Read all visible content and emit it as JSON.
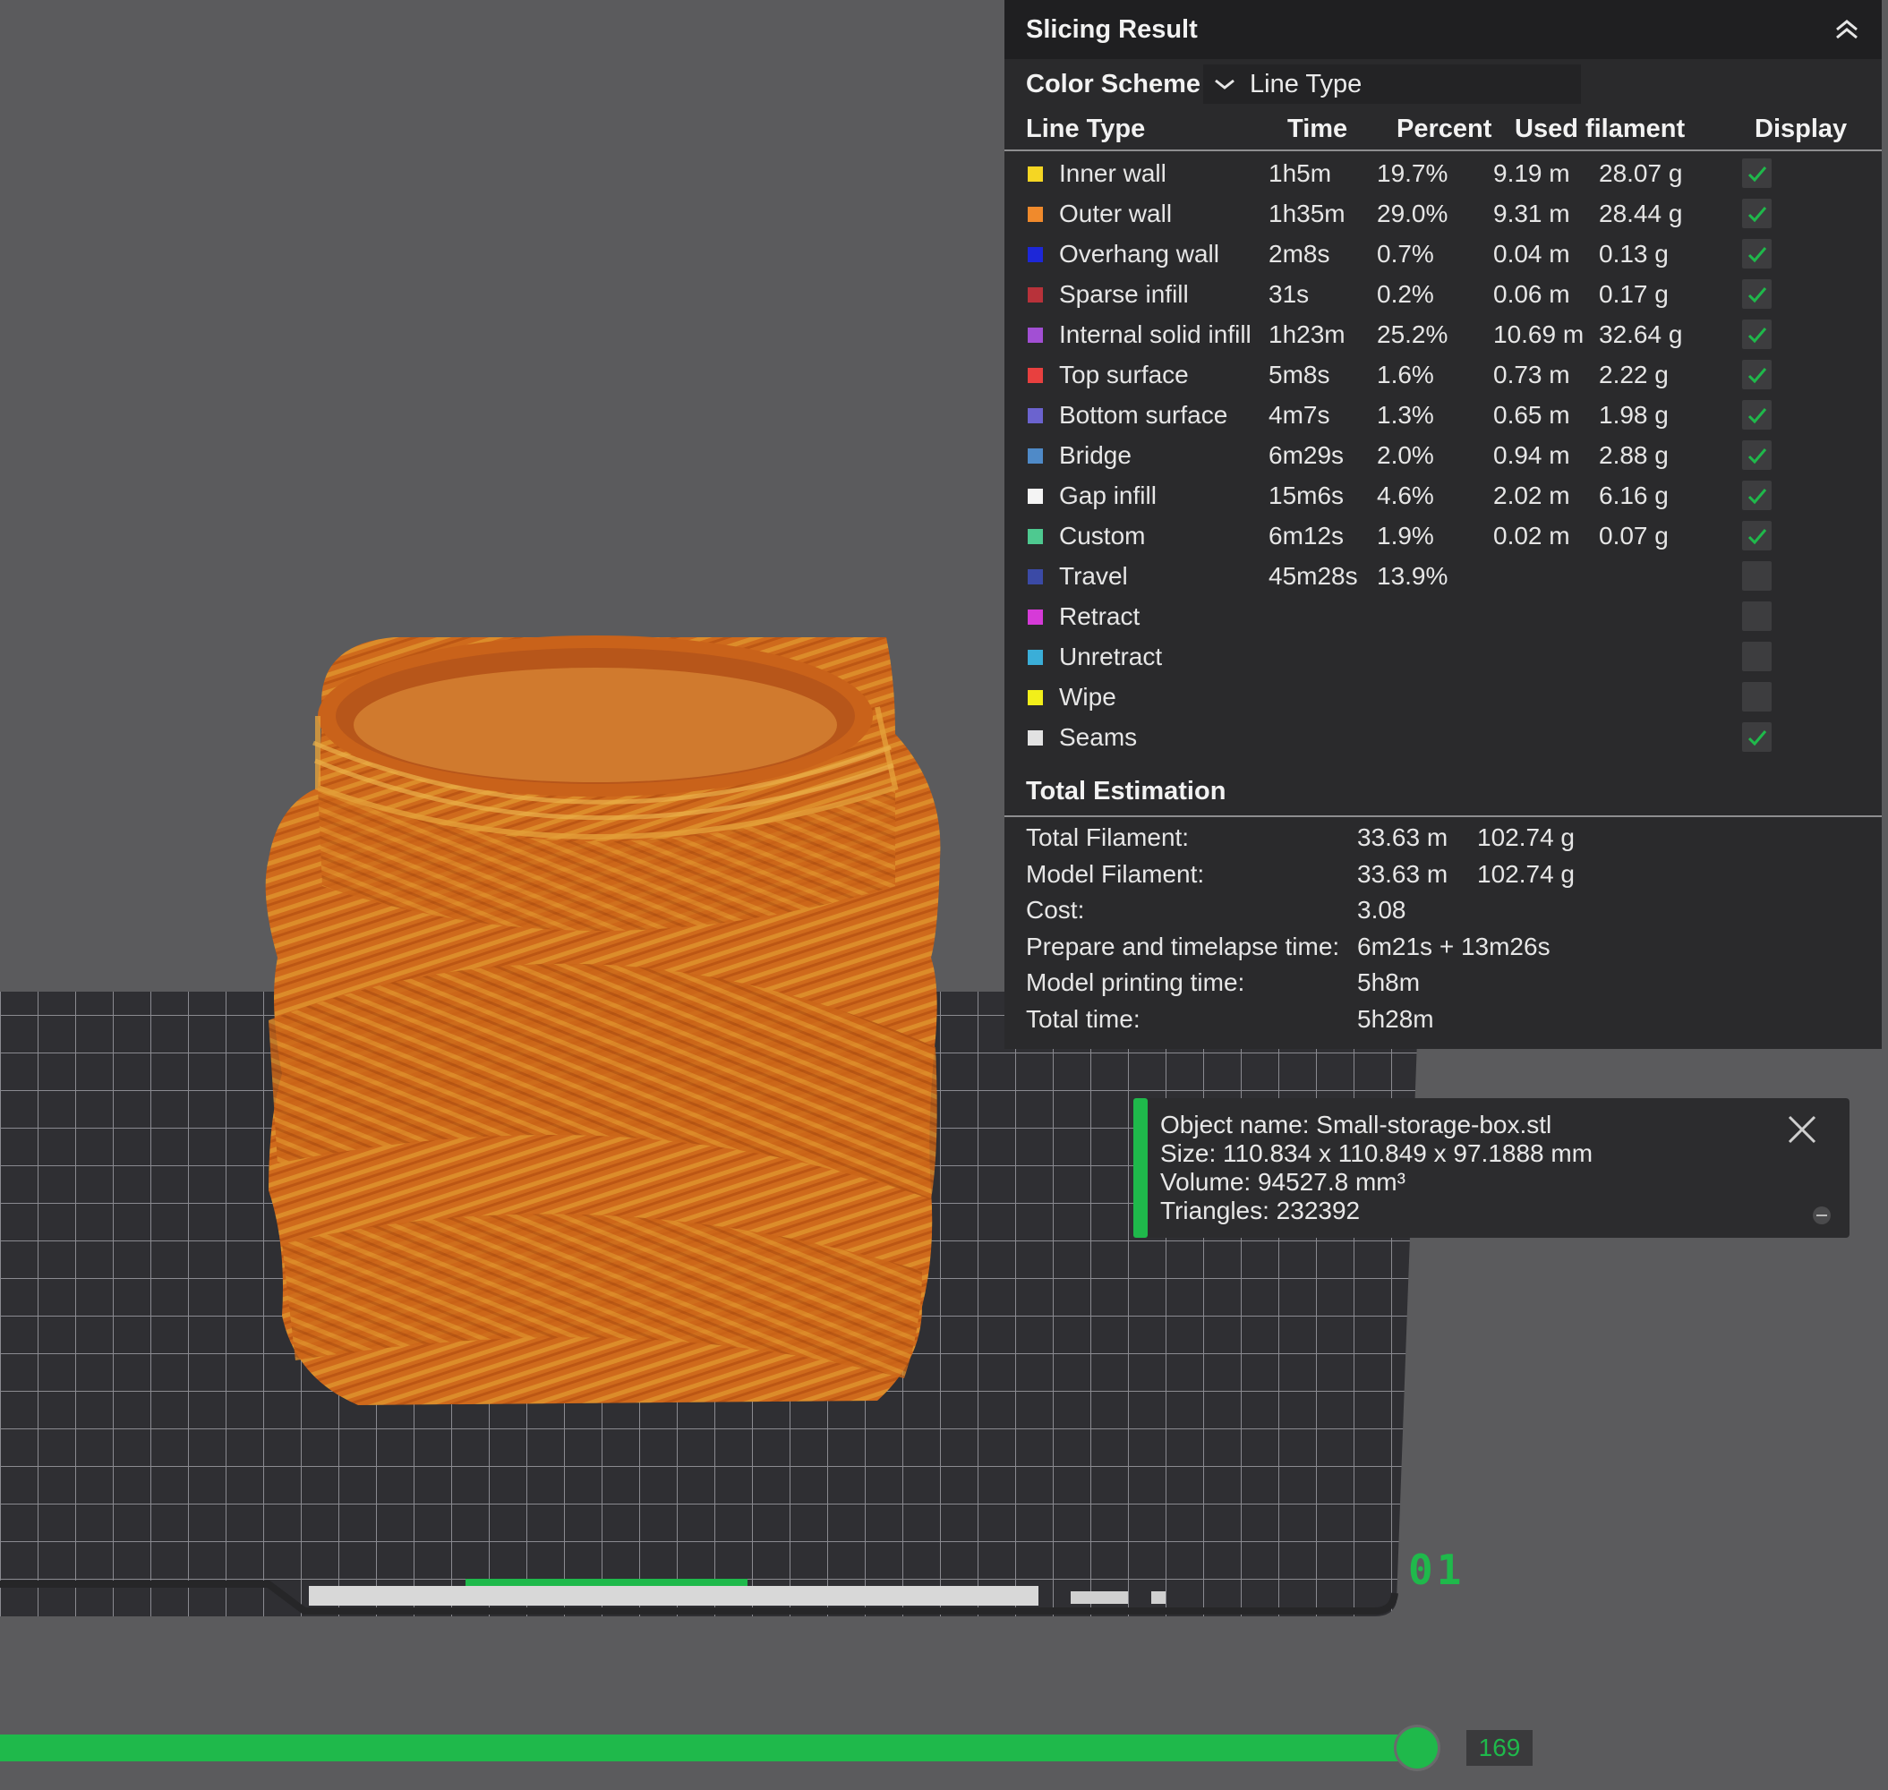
{
  "panel": {
    "title": "Slicing Result",
    "color_scheme_label": "Color Scheme",
    "color_scheme_value": "Line Type",
    "columns": {
      "line_type": "Line Type",
      "time": "Time",
      "percent": "Percent",
      "used_filament": "Used filament",
      "display": "Display"
    },
    "rows": [
      {
        "name": "Inner wall",
        "color": "#f5d623",
        "time": "1h5m",
        "percent": "19.7%",
        "length": "9.19 m",
        "weight": "28.07 g",
        "display": true
      },
      {
        "name": "Outer wall",
        "color": "#f08a2c",
        "time": "1h35m",
        "percent": "29.0%",
        "length": "9.31 m",
        "weight": "28.44 g",
        "display": true
      },
      {
        "name": "Overhang wall",
        "color": "#1d27d8",
        "time": "2m8s",
        "percent": "0.7%",
        "length": "0.04 m",
        "weight": "0.13 g",
        "display": true
      },
      {
        "name": "Sparse infill",
        "color": "#b8323a",
        "time": "31s",
        "percent": "0.2%",
        "length": "0.06 m",
        "weight": "0.17 g",
        "display": true
      },
      {
        "name": "Internal solid infill",
        "color": "#a24fd4",
        "time": "1h23m",
        "percent": "25.2%",
        "length": "10.69 m",
        "weight": "32.64 g",
        "display": true
      },
      {
        "name": "Top surface",
        "color": "#e8403f",
        "time": "5m8s",
        "percent": "1.6%",
        "length": "0.73 m",
        "weight": "2.22 g",
        "display": true
      },
      {
        "name": "Bottom surface",
        "color": "#6b63cf",
        "time": "4m7s",
        "percent": "1.3%",
        "length": "0.65 m",
        "weight": "1.98 g",
        "display": true
      },
      {
        "name": "Bridge",
        "color": "#4f8ac8",
        "time": "6m29s",
        "percent": "2.0%",
        "length": "0.94 m",
        "weight": "2.88 g",
        "display": true
      },
      {
        "name": "Gap infill",
        "color": "#f4f4f4",
        "time": "15m6s",
        "percent": "4.6%",
        "length": "2.02 m",
        "weight": "6.16 g",
        "display": true
      },
      {
        "name": "Custom",
        "color": "#4ec990",
        "time": "6m12s",
        "percent": "1.9%",
        "length": "0.02 m",
        "weight": "0.07 g",
        "display": true
      },
      {
        "name": "Travel",
        "color": "#3b4aa6",
        "time": "45m28s",
        "percent": "13.9%",
        "length": "",
        "weight": "",
        "display": false
      },
      {
        "name": "Retract",
        "color": "#d63ad8",
        "time": "",
        "percent": "",
        "length": "",
        "weight": "",
        "display": false
      },
      {
        "name": "Unretract",
        "color": "#3aaed8",
        "time": "",
        "percent": "",
        "length": "",
        "weight": "",
        "display": false
      },
      {
        "name": "Wipe",
        "color": "#f2ef1a",
        "time": "",
        "percent": "",
        "length": "",
        "weight": "",
        "display": false
      },
      {
        "name": "Seams",
        "color": "#e2e2e2",
        "time": "",
        "percent": "",
        "length": "",
        "weight": "",
        "display": true
      }
    ],
    "total_title": "Total Estimation",
    "totals": [
      {
        "label": "Total Filament:",
        "value": "33.63 m",
        "extra": "102.74 g"
      },
      {
        "label": "Model Filament:",
        "value": "33.63 m",
        "extra": "102.74 g"
      },
      {
        "label": "Cost:",
        "value": "3.08",
        "extra": ""
      },
      {
        "label": "Prepare and timelapse time:",
        "value": "6m21s + 13m26s",
        "extra": ""
      },
      {
        "label": "Model printing time:",
        "value": "5h8m",
        "extra": ""
      },
      {
        "label": "Total time:",
        "value": "5h28m",
        "extra": ""
      }
    ]
  },
  "object_info": {
    "name": "Object name: Small-storage-box.stl",
    "size": "Size: 110.834 x 110.849 x 97.1888 mm",
    "volume": "Volume: 94527.8 mm³",
    "triangles": "Triangles: 232392"
  },
  "viewport": {
    "plate_label": "01",
    "model_color": "#d2691e"
  },
  "layer_slider": {
    "value": "169",
    "level": 0.76
  },
  "colors": {
    "accent": "#1fb94b",
    "panel_bg": "#2a2a2c",
    "background": "#5b5b5d"
  }
}
